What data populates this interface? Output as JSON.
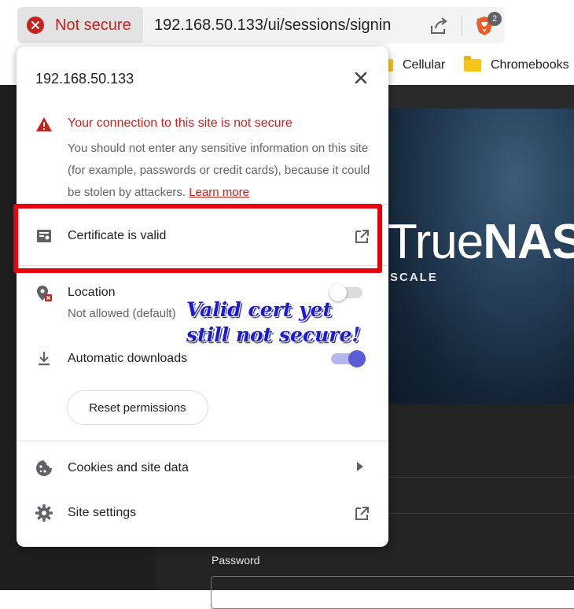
{
  "browser": {
    "security_chip_label": "Not secure",
    "url": "192.168.50.133/ui/sessions/signin",
    "extension_badge_count": "2",
    "bookmarks": [
      "Cellular",
      "Chromebooks"
    ]
  },
  "page": {
    "logo_text_true": "True",
    "logo_text_nas": "NAS",
    "logo_subtext": "SCALE",
    "password_label": "Password"
  },
  "popup": {
    "host": "192.168.50.133",
    "warning_title": "Your connection to this site is not secure",
    "warning_body": "You should not enter any sensitive information on this site (for example, passwords or credit cards), because it could be stolen by attackers.",
    "learn_more": "Learn more",
    "certificate_label": "Certificate is valid",
    "location_label": "Location",
    "location_status": "Not allowed (default)",
    "location_enabled": false,
    "downloads_label": "Automatic downloads",
    "downloads_enabled": true,
    "reset_button": "Reset permissions",
    "cookies_label": "Cookies and site data",
    "site_settings_label": "Site settings"
  },
  "annotation": {
    "line1": "Valid cert yet",
    "line2": "still not secure!"
  },
  "colors": {
    "danger": "#c5221f",
    "toggle_on": "#5b5bd6",
    "annotation_box": "#e8000c",
    "annotation_text": "#1b1bd6"
  }
}
